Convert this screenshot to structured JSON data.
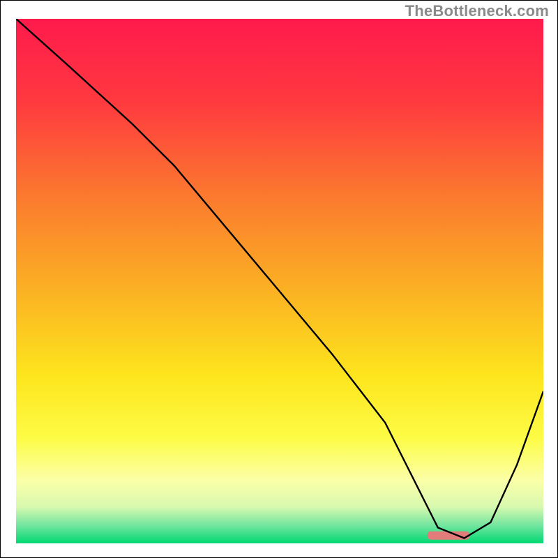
{
  "watermark": "TheBottleneck.com",
  "chart_data": {
    "type": "line",
    "title": "",
    "xlabel": "",
    "ylabel": "",
    "xlim": [
      0,
      100
    ],
    "ylim": [
      0,
      100
    ],
    "grid": false,
    "legend": false,
    "background_gradient_stops": [
      {
        "offset": 0.0,
        "color": "#ff1a4c"
      },
      {
        "offset": 0.16,
        "color": "#ff3a3f"
      },
      {
        "offset": 0.34,
        "color": "#fb7a2e"
      },
      {
        "offset": 0.52,
        "color": "#fbb223"
      },
      {
        "offset": 0.68,
        "color": "#fde51d"
      },
      {
        "offset": 0.8,
        "color": "#fdfc46"
      },
      {
        "offset": 0.88,
        "color": "#fbffa8"
      },
      {
        "offset": 0.93,
        "color": "#d8f9af"
      },
      {
        "offset": 0.965,
        "color": "#75e6a0"
      },
      {
        "offset": 1.0,
        "color": "#00d873"
      }
    ],
    "series": [
      {
        "name": "bottleneck-curve",
        "color": "#000000",
        "x": [
          0,
          10,
          22,
          30,
          40,
          50,
          60,
          70,
          76,
          80,
          85,
          90,
          95,
          100
        ],
        "y": [
          100,
          91,
          80,
          72,
          60,
          48,
          36,
          23,
          11,
          3,
          1,
          4,
          15,
          29
        ]
      }
    ],
    "marker": {
      "name": "optimal-range",
      "x_start": 78,
      "x_end": 86,
      "y": 1.5,
      "color": "#e27c7a",
      "thickness_pct": 1.6
    }
  }
}
